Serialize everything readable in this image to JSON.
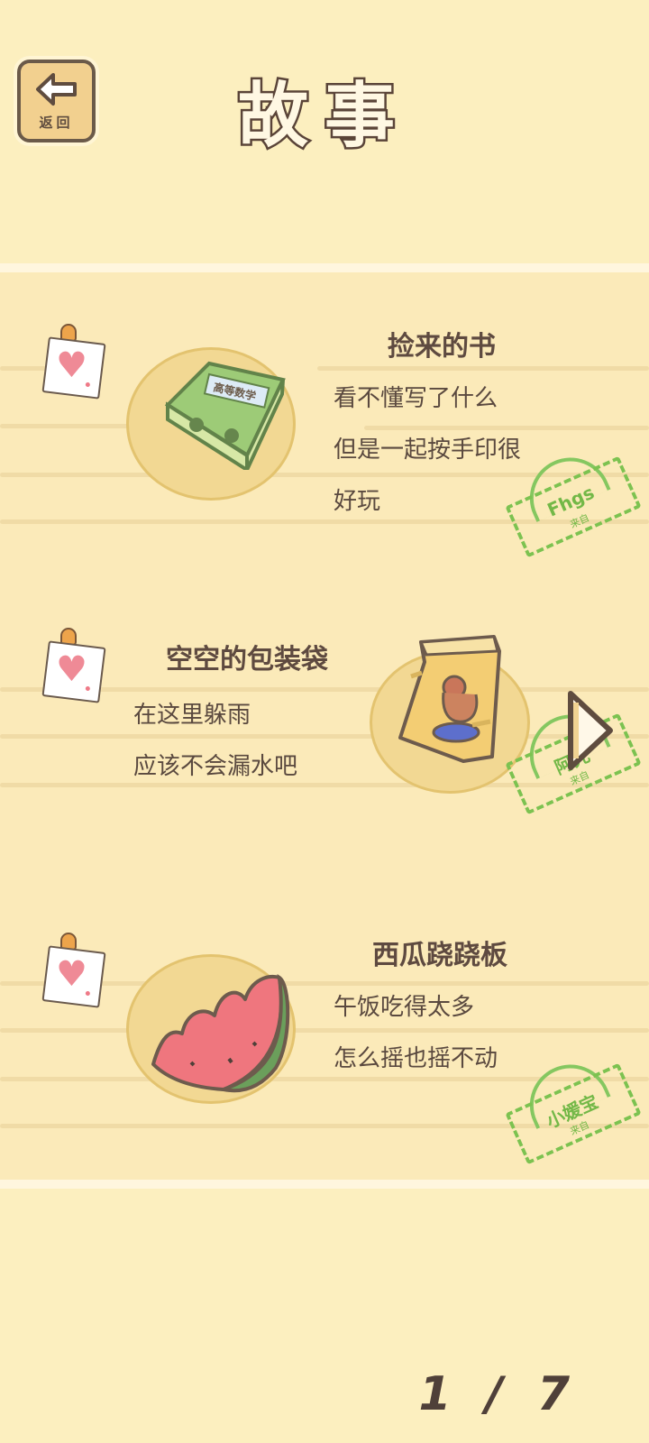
{
  "header": {
    "back_label": "返回",
    "title": "故事"
  },
  "stories": [
    {
      "title": "捡来的书",
      "lines": [
        "看不懂写了什么",
        "但是一起按手印很",
        "好玩"
      ],
      "item_label": "高等数学",
      "stamp_name": "Fhgs",
      "stamp_sub": "来自"
    },
    {
      "title": "空空的包装袋",
      "lines": [
        "在这里躲雨",
        "应该不会漏水吧"
      ],
      "stamp_name": "阿先",
      "stamp_sub": "来自"
    },
    {
      "title": "西瓜跷跷板",
      "lines": [
        "午饭吃得太多",
        "怎么摇也摇不动"
      ],
      "stamp_name": "小媛宝",
      "stamp_sub": "来自"
    }
  ],
  "pagination": {
    "text": "1 / 7"
  },
  "colors": {
    "background": "#fcefbf",
    "text_dark": "#5a493f",
    "stamp_green": "#7cc250",
    "heart_pink": "#ef8a96"
  },
  "icons": {
    "back": "back-arrow-icon",
    "next": "chevron-right-icon"
  }
}
